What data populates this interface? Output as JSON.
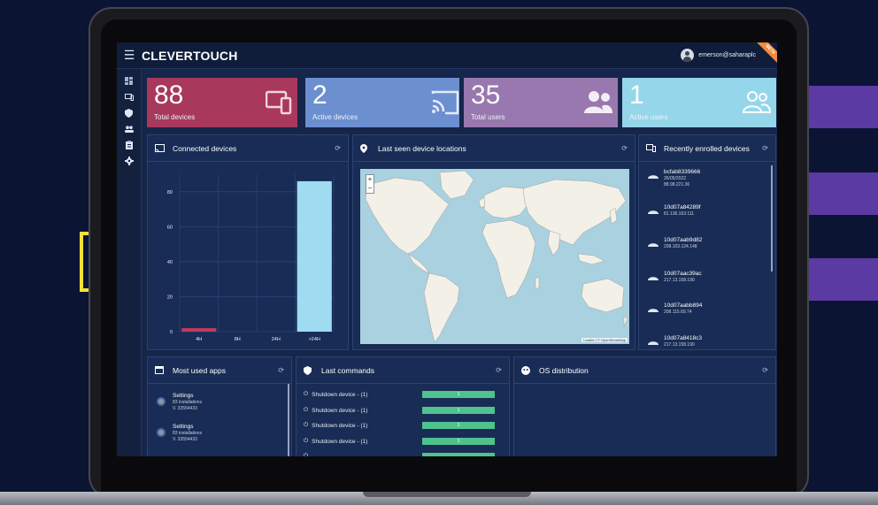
{
  "app": {
    "brand": "CLEVERTOUCH",
    "ribbon": "BETA",
    "user": "emerson@saharaplc"
  },
  "nav_icons": [
    "dashboard-icon",
    "devices-icon",
    "shield-icon",
    "users-icon",
    "clipboard-icon",
    "settings-icon"
  ],
  "stats": [
    {
      "value": "88",
      "label": "Total devices",
      "color": "#a8385c",
      "icon": "devices-icon"
    },
    {
      "value": "2",
      "label": "Active devices",
      "color": "#6c8fd0",
      "icon": "cast-icon"
    },
    {
      "value": "35",
      "label": "Total users",
      "color": "#9878ae",
      "icon": "users-icon"
    },
    {
      "value": "1",
      "label": "Active users",
      "color": "#96d6ea",
      "icon": "users-outline-icon"
    }
  ],
  "connected_devices": {
    "title": "Connected devices",
    "chart_data": {
      "type": "bar",
      "categories": [
        "4H",
        "8H",
        "24H",
        ">24H"
      ],
      "values": [
        2,
        0,
        0,
        86
      ],
      "ylim": [
        0,
        90
      ],
      "yticks": [
        0,
        20,
        40,
        60,
        80
      ],
      "grid": true,
      "colors": [
        "#c03a5e",
        "#c03a5e",
        "#c03a5e",
        "#9fdcf2"
      ]
    }
  },
  "map": {
    "title": "Last seen device locations",
    "zoom_in": "+",
    "zoom_out": "−",
    "attribution": "Leaflet | © OpenStreetMap"
  },
  "enrolled": {
    "title": "Recently enrolled devices",
    "items": [
      {
        "id": "bcfab8339666",
        "date": "26/05/2022",
        "ip": "88.98.221.36"
      },
      {
        "id": "10d07a84289f",
        "date": "",
        "ip": "81.136.163.111"
      },
      {
        "id": "10d07aab9d82",
        "date": "",
        "ip": "208.103.124.148"
      },
      {
        "id": "10d07aac39ac",
        "date": "",
        "ip": "217.13.158.190"
      },
      {
        "id": "10d07aabb894",
        "date": "",
        "ip": "208.115.69.74"
      },
      {
        "id": "10d07a8418c3",
        "date": "",
        "ip": "217.13.158.190"
      }
    ]
  },
  "apps": {
    "title": "Most used apps",
    "items": [
      {
        "name": "Settings",
        "installs": "83 installations",
        "version": "V. 33554433"
      },
      {
        "name": "Settings",
        "installs": "83 installations",
        "version": "V. 33554433"
      }
    ]
  },
  "commands": {
    "title": "Last commands",
    "items": [
      {
        "label": "Shutdown device  - (1)",
        "count": "1"
      },
      {
        "label": "Shutdown device  - (1)",
        "count": "1"
      },
      {
        "label": "Shutdown device  - (1)",
        "count": "1"
      },
      {
        "label": "Shutdown device  - (1)",
        "count": "1"
      }
    ]
  },
  "os": {
    "title": "OS distribution"
  }
}
